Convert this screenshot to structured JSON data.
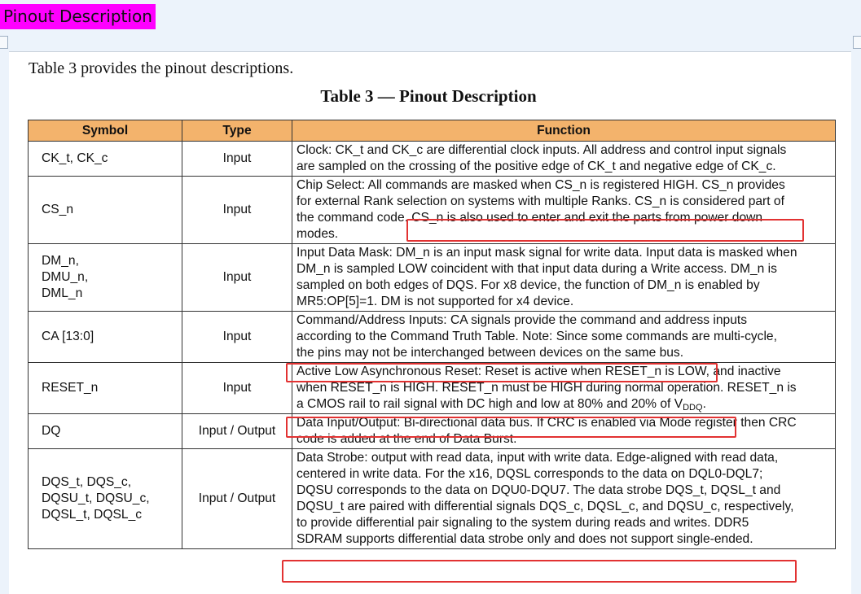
{
  "heading": "Pinout Description",
  "intro": "Table 3 provides the pinout descriptions.",
  "caption": "Table 3 — Pinout Description",
  "columns": [
    "Symbol",
    "Type",
    "Function"
  ],
  "rows": [
    {
      "symbol_lines": [
        "CK_t, CK_c"
      ],
      "type": "Input",
      "function_lines": [
        "Clock: CK_t and CK_c are differential clock inputs. All address and control input signals",
        "are sampled on the crossing of the positive edge of CK_t and negative edge of CK_c."
      ]
    },
    {
      "symbol_lines": [
        "CS_n"
      ],
      "type": "Input",
      "function_lines": [
        "Chip Select: All commands are masked when CS_n is registered HIGH. CS_n provides",
        "for external Rank selection on systems with multiple Ranks. CS_n is considered part of",
        "the command code. CS_n is also used to enter and exit the parts from power down",
        "modes."
      ]
    },
    {
      "symbol_lines": [
        "DM_n,",
        "DMU_n,",
        "DML_n"
      ],
      "type": "Input",
      "function_lines": [
        "Input Data Mask: DM_n is an input mask signal for write data. Input data is masked when",
        "DM_n is sampled LOW coincident with that input data during a Write access. DM_n is",
        "sampled on both edges of DQS. For x8 device, the function of DM_n is enabled by",
        "MR5:OP[5]=1. DM is not supported for x4 device."
      ]
    },
    {
      "symbol_lines": [
        "CA [13:0]"
      ],
      "type": "Input",
      "function_lines": [
        "Command/Address Inputs: CA signals provide the command and address inputs",
        "according to the Command Truth Table. Note: Since some commands are multi-cycle,",
        "the pins may not be interchanged between devices on the same bus."
      ]
    },
    {
      "symbol_lines": [
        "RESET_n"
      ],
      "type": "Input",
      "function_lines": [
        "Active Low Asynchronous Reset: Reset is active when RESET_n is LOW, and inactive",
        "when RESET_n is HIGH. RESET_n must be HIGH during normal operation. RESET_n is",
        "a CMOS rail to rail signal with DC high and low at 80% and 20% of V"
      ],
      "subscript": "DDQ",
      "subscript_tail": "."
    },
    {
      "symbol_lines": [
        "DQ"
      ],
      "type": "Input / Output",
      "function_lines": [
        "Data Input/Output: Bi-directional data bus. If CRC is enabled via Mode register then CRC",
        "code is added at the end of Data Burst."
      ]
    },
    {
      "symbol_lines": [
        "DQS_t, DQS_c,",
        "DQSU_t, DQSU_c,",
        "DQSL_t, DQSL_c"
      ],
      "type": "Input / Output",
      "function_lines": [
        "Data Strobe: output with read data, input with write data. Edge-aligned with read data,",
        "centered in write data. For the x16, DQSL corresponds to the data on DQL0-DQL7;",
        "DQSU corresponds to the data on DQU0-DQU7. The data strobe DQS_t, DQSL_t and",
        "DQSU_t are paired with differential signals DQS_c, DQSL_c, and DQSU_c, respectively,",
        "to provide differential pair signaling to the system during reads and writes. DDR5",
        "SDRAM supports differential data strobe only and does not support single-ended."
      ]
    }
  ],
  "colors": {
    "highlight_border": "#e23232",
    "header_fill": "#f3b36c",
    "heading_tag": "#ff00ff"
  }
}
